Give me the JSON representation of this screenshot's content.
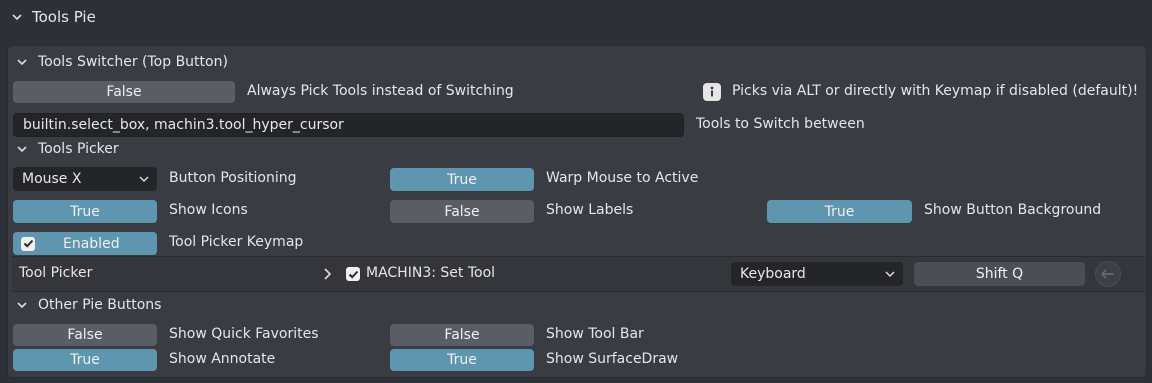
{
  "header": {
    "title": "Tools Pie"
  },
  "switcher": {
    "title": "Tools Switcher (Top Button)",
    "always_pick_value": "False",
    "always_pick_label": "Always Pick Tools instead of Switching",
    "info_text": "Picks via ALT or directly with Keymap if disabled (default)!",
    "tools_value": "builtin.select_box, machin3.tool_hyper_cursor",
    "tools_label": "Tools to Switch between"
  },
  "picker": {
    "title": "Tools Picker",
    "positioning_value": "Mouse X",
    "positioning_label": "Button Positioning",
    "warp_value": "True",
    "warp_label": "Warp Mouse to Active",
    "icons_value": "True",
    "icons_label": "Show Icons",
    "labels_value": "False",
    "labels_label": "Show Labels",
    "bg_value": "True",
    "bg_label": "Show Button Background",
    "keymap_toggle": "Enabled",
    "keymap_label": "Tool Picker Keymap",
    "keymap_row": {
      "name": "Tool Picker",
      "operator": "MACHIN3: Set Tool",
      "input_type": "Keyboard",
      "key": "Shift Q"
    }
  },
  "other": {
    "title": "Other Pie Buttons",
    "favorites_value": "False",
    "favorites_label": "Show Quick Favorites",
    "toolbar_value": "False",
    "toolbar_label": "Show Tool Bar",
    "annotate_value": "True",
    "annotate_label": "Show Annotate",
    "surfacedraw_value": "True",
    "surfacedraw_label": "Show SurfaceDraw"
  },
  "colors": {
    "background": "#2e3037",
    "panel": "#3a3c43",
    "button_true": "#5d96ae",
    "button_false": "#5b5d66",
    "field": "#242528"
  },
  "icons": [
    "chevron-down-icon",
    "chevron-right-icon",
    "info-icon",
    "checkbox-checked-icon",
    "remove-icon"
  ]
}
